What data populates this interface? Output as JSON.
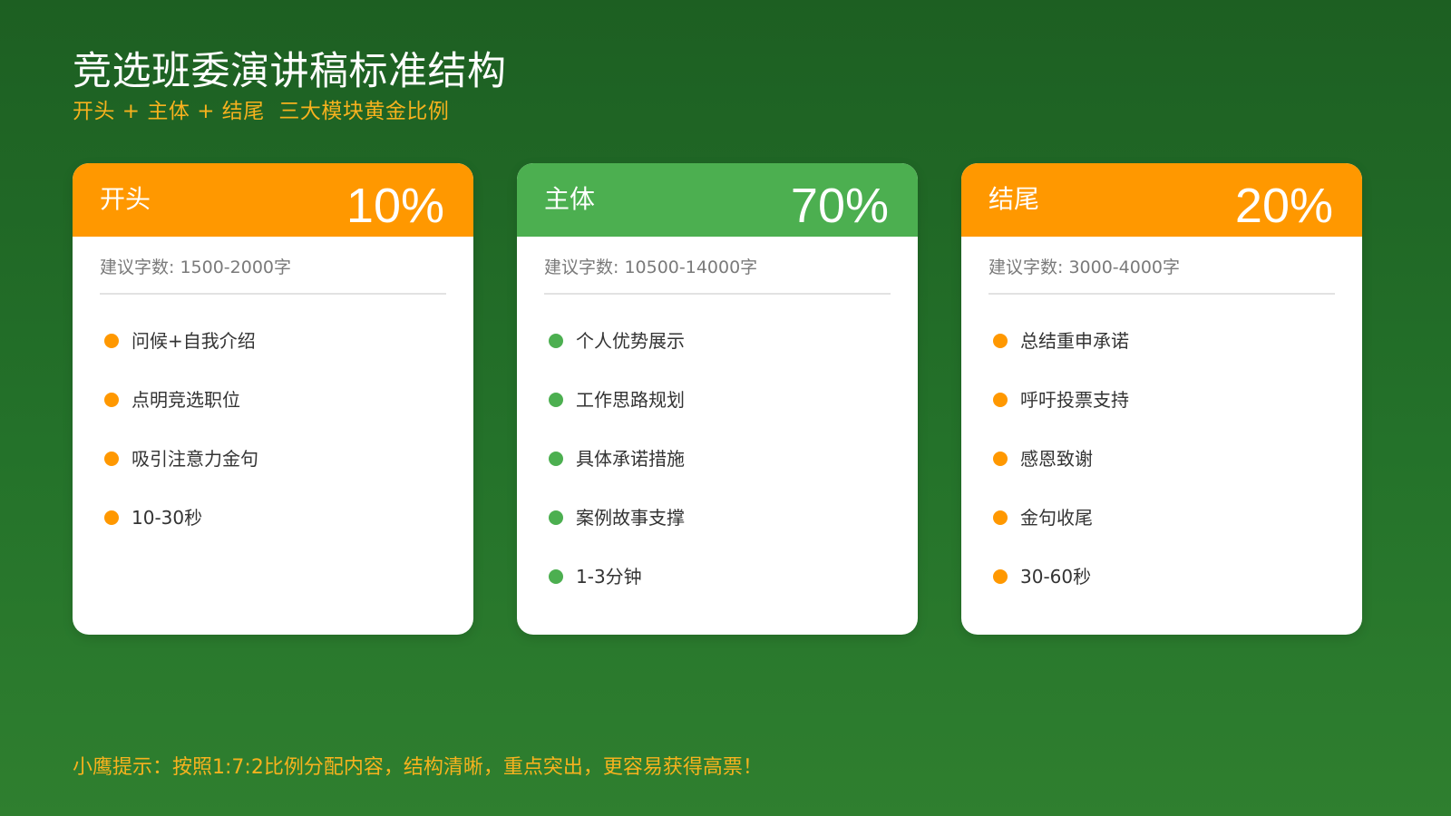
{
  "header": {
    "title": "竞选班委演讲稿标准结构",
    "subtitle": "开头 + 主体 + 结尾  三大模块黄金比例"
  },
  "colors": {
    "background": "#1d5f22",
    "orange": "#ff9800",
    "green": "#4caf50",
    "tip_text": "#f7b21e"
  },
  "cards": [
    {
      "name": "开头",
      "percent": "10%",
      "share": 0.1,
      "color": "#ff9800",
      "word_count": "建议字数: 1500-2000字",
      "items": [
        "问候+自我介绍",
        "点明竞选职位",
        "吸引注意力金句",
        "10-30秒"
      ]
    },
    {
      "name": "主体",
      "percent": "70%",
      "share": 0.7,
      "color": "#4caf50",
      "word_count": "建议字数: 10500-14000字",
      "items": [
        "个人优势展示",
        "工作思路规划",
        "具体承诺措施",
        "案例故事支撑",
        "1-3分钟"
      ]
    },
    {
      "name": "结尾",
      "percent": "20%",
      "share": 0.2,
      "color": "#ff9800",
      "word_count": "建议字数: 3000-4000字",
      "items": [
        "总结重申承诺",
        "呼吁投票支持",
        "感恩致谢",
        "金句收尾",
        "30-60秒"
      ]
    }
  ],
  "footer": {
    "tip": "小鹰提示：按照1:7:2比例分配内容，结构清晰，重点突出，更容易获得高票！"
  }
}
